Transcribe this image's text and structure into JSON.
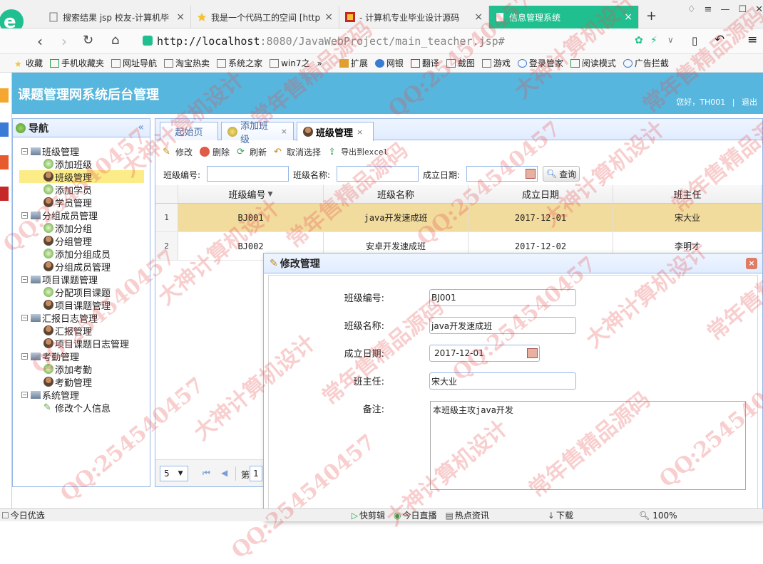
{
  "browser": {
    "tabs": [
      {
        "label": "搜索结果 jsp 校友-计算机毕"
      },
      {
        "label": "我是一个代码工的空间 [http"
      },
      {
        "label": "- 计算机专业毕业设计源码"
      },
      {
        "label": "信息管理系统"
      }
    ],
    "url_host": "http://localhost",
    "url_path": ":8080/JavaWebProject/main_teacher.jsp#",
    "bookmarks": [
      "收藏",
      "手机收藏夹",
      "网址导航",
      "淘宝热卖",
      "系统之家",
      "win7之",
      "»",
      "扩展",
      "网银",
      "翻译",
      "截图",
      "游戏",
      "登录管家",
      "阅读模式",
      "广告拦截"
    ]
  },
  "app": {
    "title": "课题管理网系统后台管理",
    "greeting": "您好，TH001",
    "separator": "|",
    "logout": "退出"
  },
  "nav": {
    "title": "导航",
    "collapse": "«",
    "tree": [
      {
        "label": "班级管理",
        "group": true
      },
      {
        "label": "添加班级"
      },
      {
        "label": "班级管理",
        "selected": true
      },
      {
        "label": "添加学员"
      },
      {
        "label": "学员管理"
      },
      {
        "label": "分组成员管理",
        "group": true
      },
      {
        "label": "添加分组"
      },
      {
        "label": "分组管理"
      },
      {
        "label": "添加分组成员"
      },
      {
        "label": "分组成员管理"
      },
      {
        "label": "项目课题管理",
        "group": true
      },
      {
        "label": "分配项目课题"
      },
      {
        "label": "项目课题管理"
      },
      {
        "label": "汇报日志管理",
        "group": true
      },
      {
        "label": "汇报管理"
      },
      {
        "label": "项目课题日志管理"
      },
      {
        "label": "考勤管理",
        "group": true
      },
      {
        "label": "添加考勤"
      },
      {
        "label": "考勤管理"
      },
      {
        "label": "系统管理",
        "group": true
      },
      {
        "label": "修改个人信息"
      }
    ]
  },
  "main": {
    "tabs": [
      {
        "label": "起始页"
      },
      {
        "label": "添加班级",
        "close": "×"
      },
      {
        "label": "班级管理",
        "close": "×"
      }
    ],
    "toolbar": {
      "edit": "修改",
      "delete": "删除",
      "refresh": "刷新",
      "unselect": "取消选择",
      "export": "导出到excel"
    },
    "search": {
      "class_no_label": "班级编号:",
      "class_name_label": "班级名称:",
      "date_label": "成立日期:",
      "query": "查询"
    },
    "grid": {
      "columns": [
        "班级编号",
        "班级名称",
        "成立日期",
        "班主任"
      ],
      "rows": [
        {
          "n": "1",
          "no": "BJ001",
          "name": "java开发速成班",
          "date": "2017-12-01",
          "teacher": "宋大业"
        },
        {
          "n": "2",
          "no": "BJ002",
          "name": "安卓开发速成班",
          "date": "2017-12-02",
          "teacher": "李明才"
        }
      ]
    },
    "pager": {
      "page_size": "5",
      "page_label": "第",
      "page_no": "1"
    }
  },
  "dialog": {
    "title": "修改管理",
    "close": "×",
    "fields": {
      "class_no_label": "班级编号:",
      "class_no": "BJ001",
      "class_name_label": "班级名称:",
      "class_name": "java开发速成班",
      "date_label": "成立日期:",
      "date": "2017-12-01",
      "teacher_label": "班主任:",
      "teacher": "宋大业",
      "remark_label": "备注:",
      "remark": "本班级主攻java开发"
    }
  },
  "statusbar": [
    "今日优选",
    "快剪辑",
    "今日直播",
    "热点资讯",
    "下载",
    "100%"
  ],
  "watermark": [
    "QQ:254540457",
    "大神计算机设计",
    "常年售精品源码"
  ],
  "colors": {
    "header": "#56b6dd",
    "active_tab": "#1fbf8f",
    "selected_row": "#f2dc9d",
    "panel_border": "#95b8e7"
  }
}
